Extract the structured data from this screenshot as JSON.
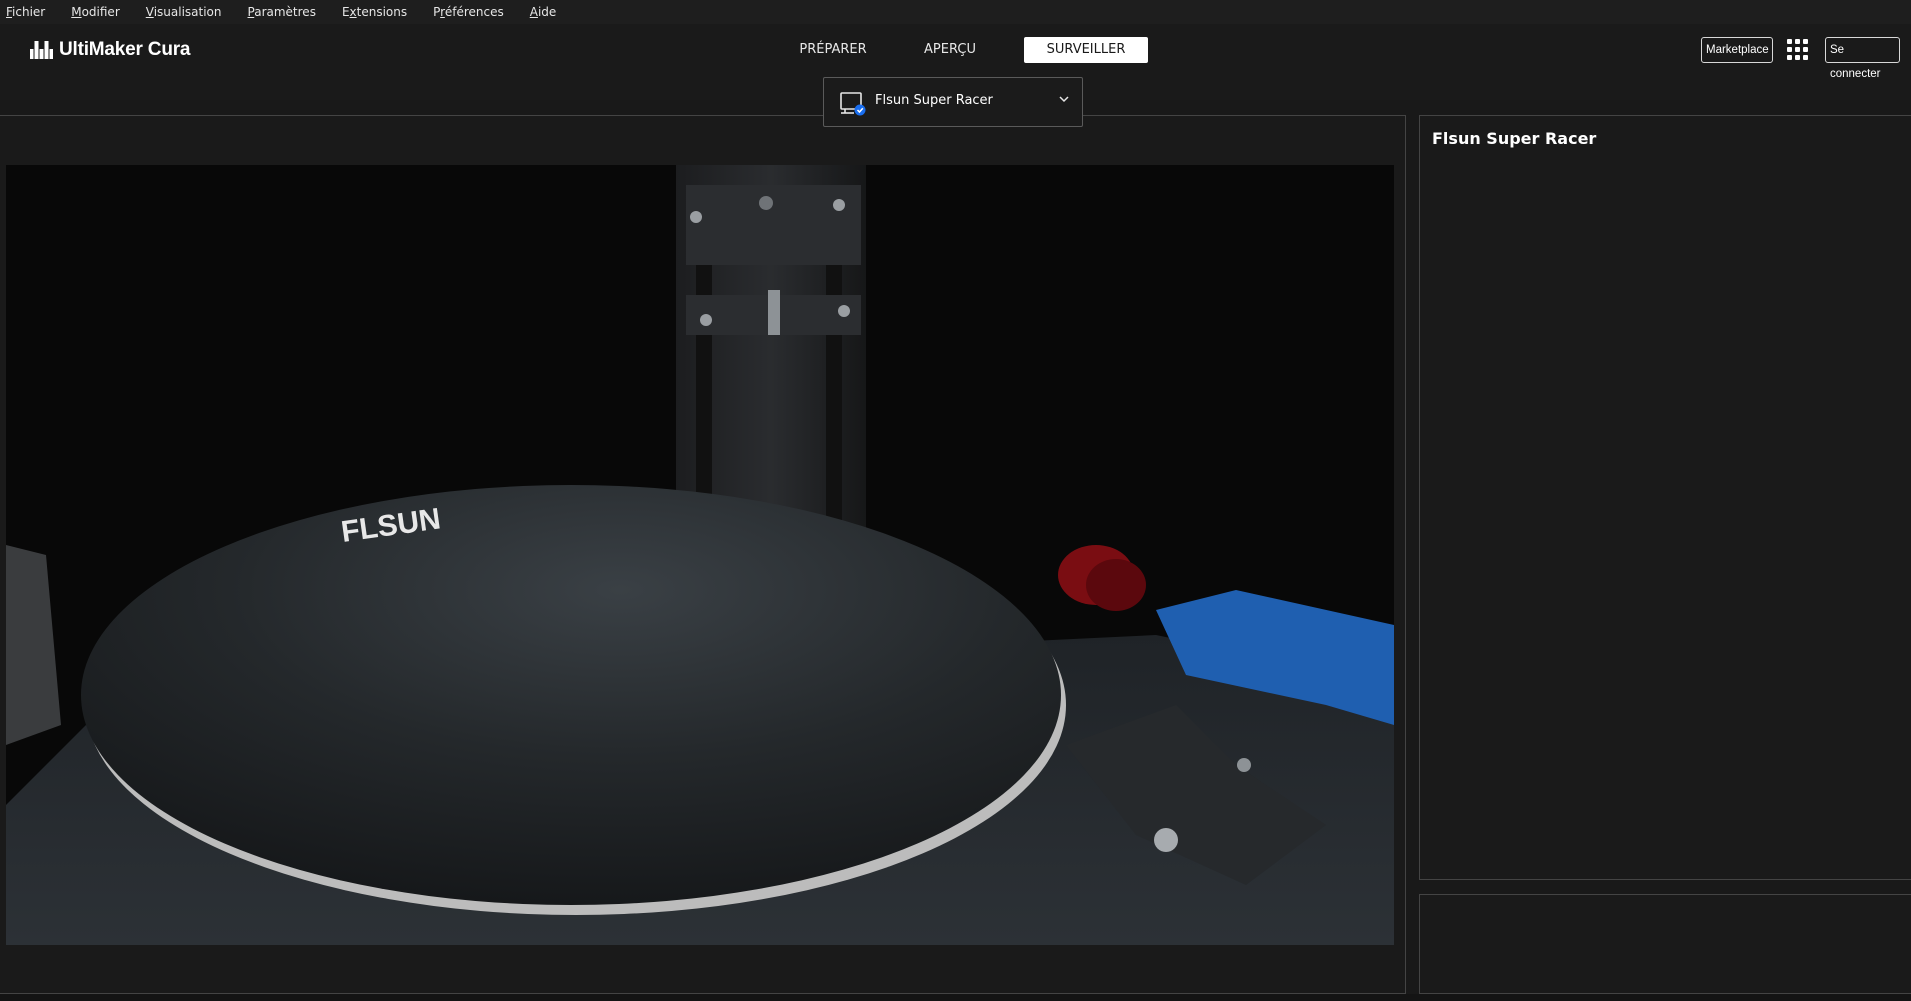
{
  "menu": {
    "items": [
      {
        "accel": "F",
        "rest": "ichier"
      },
      {
        "accel": "M",
        "rest": "odifier"
      },
      {
        "accel": "V",
        "rest": "isualisation"
      },
      {
        "accel": "P",
        "rest": "aramètres"
      },
      {
        "pre": "E",
        "accel": "x",
        "rest": "tensions"
      },
      {
        "pre": "P",
        "accel": "r",
        "rest": "éférences"
      },
      {
        "accel": "A",
        "rest": "ide"
      }
    ]
  },
  "header": {
    "app_name": "UltiMaker Cura",
    "tabs": [
      {
        "label": "PRÉPARER",
        "active": false
      },
      {
        "label": "APERÇU",
        "active": false
      },
      {
        "label": "SURVEILLER",
        "active": true
      }
    ],
    "marketplace_label": "Marketplace",
    "apps_icon": "grid-apps-icon",
    "signin_label": "Se connecter"
  },
  "printer_selector": {
    "name": "Flsun Super Racer",
    "icon": "connected-printer-icon",
    "chevron": "chevron-down-icon"
  },
  "monitor": {
    "printer_title": "Flsun Super Racer",
    "camera_feed_icon": "camera-feed"
  },
  "colors": {
    "accent": "#196ef0",
    "background": "#191919",
    "panel_border": "#444444"
  }
}
